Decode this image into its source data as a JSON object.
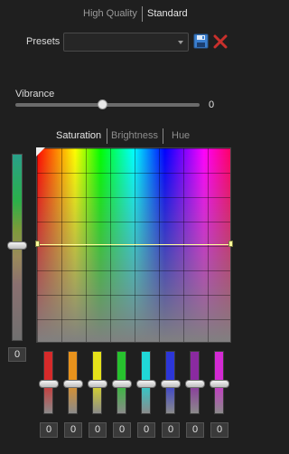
{
  "quality": {
    "options": [
      "High Quality",
      "Standard"
    ],
    "selected": "Standard"
  },
  "presets": {
    "label": "Presets",
    "value": "",
    "save_icon": "save-icon",
    "delete_icon": "delete-icon"
  },
  "vibrance": {
    "label": "Vibrance",
    "value": "0",
    "level": 0.47
  },
  "tabs": [
    {
      "label": "Saturation",
      "active": true
    },
    {
      "label": "Brightness",
      "active": false
    },
    {
      "label": "Hue",
      "active": false
    }
  ],
  "vertical_slider": {
    "value": "0"
  },
  "channels": [
    {
      "color": "#d62a2a",
      "value": "0"
    },
    {
      "color": "#e8921c",
      "value": "0"
    },
    {
      "color": "#e6e21a",
      "value": "0"
    },
    {
      "color": "#27c22e",
      "value": "0"
    },
    {
      "color": "#20d8d8",
      "value": "0"
    },
    {
      "color": "#2c36d8",
      "value": "0"
    },
    {
      "color": "#8a2aa0",
      "value": "0"
    },
    {
      "color": "#d32ad3",
      "value": "0"
    }
  ],
  "colors": {
    "background": "#1f1f1f",
    "accent_red": "#c9302c",
    "save_blue": "#3a7fd0",
    "curve": "#ffff9a"
  }
}
